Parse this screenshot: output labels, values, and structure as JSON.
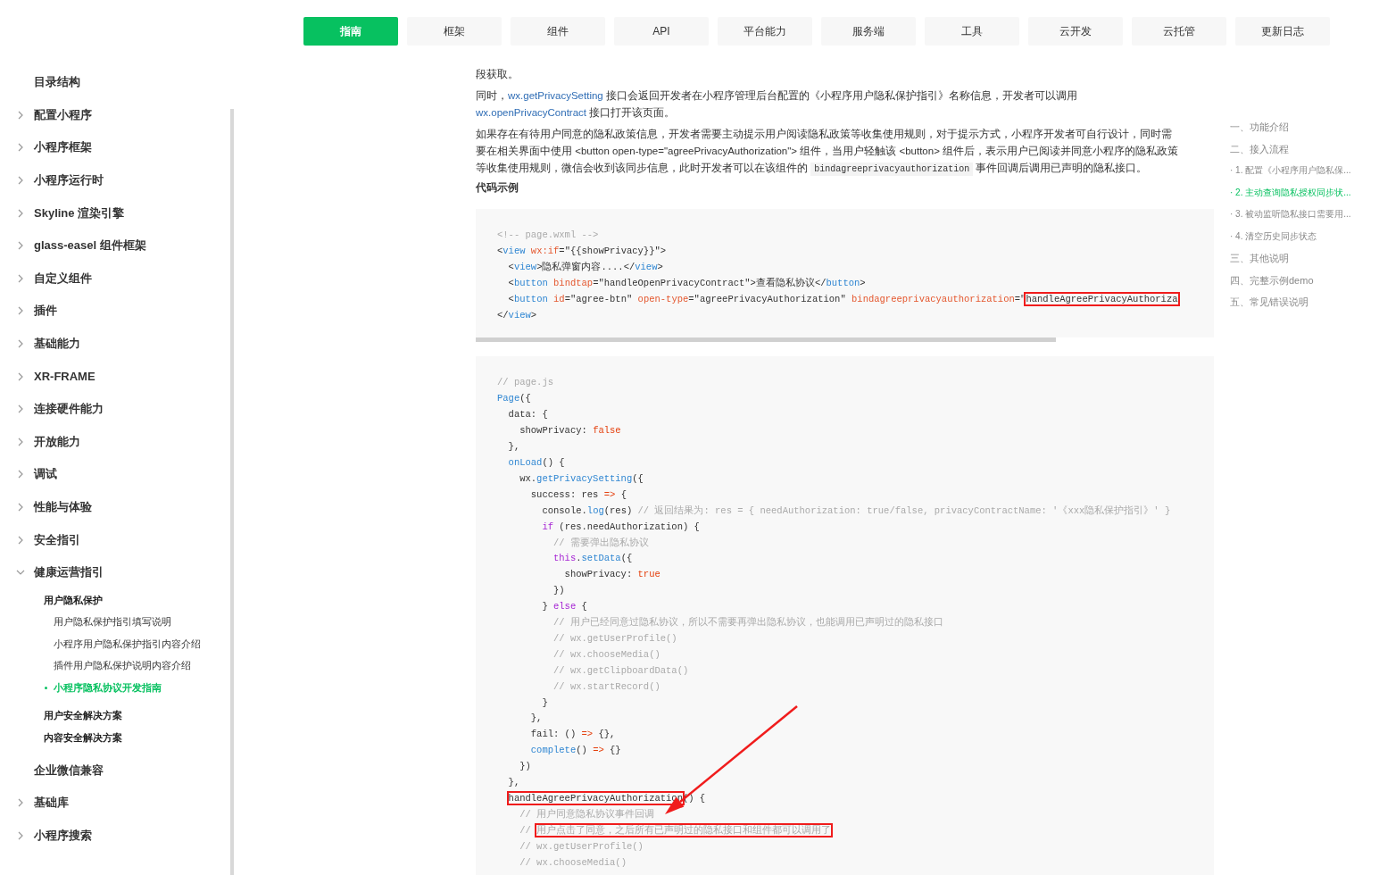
{
  "nav": {
    "tabs": [
      {
        "label": "指南",
        "selected": true
      },
      {
        "label": "框架",
        "selected": false
      },
      {
        "label": "组件",
        "selected": false
      },
      {
        "label": "API",
        "selected": false
      },
      {
        "label": "平台能力",
        "selected": false
      },
      {
        "label": "服务端",
        "selected": false
      },
      {
        "label": "工具",
        "selected": false
      },
      {
        "label": "云开发",
        "selected": false
      },
      {
        "label": "云托管",
        "selected": false
      },
      {
        "label": "更新日志",
        "selected": false
      }
    ]
  },
  "sidebar": {
    "items": [
      {
        "label": "目录结构",
        "kind": "page"
      },
      {
        "label": "配置小程序",
        "kind": "group",
        "expanded": false
      },
      {
        "label": "小程序框架",
        "kind": "group",
        "expanded": false
      },
      {
        "label": "小程序运行时",
        "kind": "group",
        "expanded": false
      },
      {
        "label": "Skyline 渲染引擎",
        "kind": "group",
        "expanded": false
      },
      {
        "label": "glass-easel 组件框架",
        "kind": "group",
        "expanded": false
      },
      {
        "label": "自定义组件",
        "kind": "group",
        "expanded": false
      },
      {
        "label": "插件",
        "kind": "group",
        "expanded": false
      },
      {
        "label": "基础能力",
        "kind": "group",
        "expanded": false
      },
      {
        "label": "XR-FRAME",
        "kind": "group",
        "expanded": false
      },
      {
        "label": "连接硬件能力",
        "kind": "group",
        "expanded": false
      },
      {
        "label": "开放能力",
        "kind": "group",
        "expanded": false
      },
      {
        "label": "调试",
        "kind": "group",
        "expanded": false
      },
      {
        "label": "性能与体验",
        "kind": "group",
        "expanded": false
      },
      {
        "label": "安全指引",
        "kind": "group",
        "expanded": false
      },
      {
        "label": "健康运营指引",
        "kind": "group",
        "expanded": true,
        "children": [
          {
            "label": "用户隐私保护",
            "selected": false,
            "children": [
              {
                "label": "用户隐私保护指引填写说明",
                "selected": false
              },
              {
                "label": "小程序用户隐私保护指引内容介绍",
                "selected": false
              },
              {
                "label": "插件用户隐私保护说明内容介绍",
                "selected": false
              },
              {
                "label": "小程序隐私协议开发指南",
                "selected": true
              }
            ]
          },
          {
            "label": "用户安全解决方案",
            "selected": false
          },
          {
            "label": "内容安全解决方案",
            "selected": false
          }
        ]
      },
      {
        "label": "企业微信兼容",
        "kind": "page"
      },
      {
        "label": "基础库",
        "kind": "group",
        "expanded": false
      },
      {
        "label": "小程序搜索",
        "kind": "group",
        "expanded": false
      }
    ]
  },
  "article": {
    "paragraphs": [
      {
        "segments": [
          {
            "kind": "text",
            "text": "段获取。"
          }
        ]
      },
      {
        "segments": [
          {
            "kind": "text",
            "text": "同时，"
          },
          {
            "kind": "link",
            "text": "wx.getPrivacySetting"
          },
          {
            "kind": "text",
            "text": " 接口会返回开发者在小程序管理后台配置的《小程序用户隐私保护指引》名称信息，开发者可以调用"
          },
          {
            "kind": "break"
          },
          {
            "kind": "link",
            "text": "wx.openPrivacyContract"
          },
          {
            "kind": "text",
            "text": " 接口打开该页面。"
          }
        ]
      },
      {
        "segments": [
          {
            "kind": "text",
            "text": "如果存在有待用户同意的隐私政策信息，开发者需要主动提示用户阅读隐私政策等收集使用规则，对于提示方式，小程序开发者可自行设计，同时需要在相关界面中使用 <button open-type=\"agreePrivacyAuthorization\"> 组件，当用户轻触该 <button> 组件后，表示用户已阅读并同意小程序的隐私政策等收集使用规则，微信会收到该同步信息，此时开发者可以在该组件的 "
          },
          {
            "kind": "code",
            "text": "bindagreeprivacyauthorization"
          },
          {
            "kind": "text",
            "text": " 事件回调后调用已声明的隐私接口。"
          }
        ]
      }
    ],
    "heading": "代码示例",
    "code_blocks": [
      {
        "scrollbar": true,
        "arrow": false,
        "lines": [
          [
            {
              "text": "<!-- page.wxml -->",
              "boxed": false
            }
          ],
          [
            {
              "text": "<view wx:if=\"{{showPrivacy}}\">",
              "boxed": false
            }
          ],
          [
            {
              "text": "  <view>隐私弹窗内容....</view>",
              "boxed": false
            }
          ],
          [
            {
              "text": "  <button bindtap=\"handleOpenPrivacyContract\">查看隐私协议</button>",
              "boxed": false
            }
          ],
          [
            {
              "text": "  <button id=\"agree-btn\" open-type=\"agreePrivacyAuthorization\" bindagreeprivacyauthorization=\"",
              "boxed": false
            },
            {
              "text": "handleAgreePrivacyAuthoriza",
              "boxed": true
            }
          ],
          [
            {
              "text": "</view>",
              "boxed": false
            }
          ]
        ]
      },
      {
        "scrollbar": false,
        "arrow": true,
        "lines": [
          [
            {
              "text": "// page.js",
              "boxed": false
            }
          ],
          [
            {
              "text": "Page({",
              "boxed": false
            }
          ],
          [
            {
              "text": "  data: {",
              "boxed": false
            }
          ],
          [
            {
              "text": "    showPrivacy: false",
              "boxed": false
            }
          ],
          [
            {
              "text": "  },",
              "boxed": false
            }
          ],
          [
            {
              "text": "  onLoad() {",
              "boxed": false
            }
          ],
          [
            {
              "text": "    wx.getPrivacySetting({",
              "boxed": false
            }
          ],
          [
            {
              "text": "      success: res => {",
              "boxed": false
            }
          ],
          [
            {
              "text": "        console.log(res) // 返回结果为: res = { needAuthorization: true/false, privacyContractName: '《xxx隐私保护指引》' }",
              "boxed": false
            }
          ],
          [
            {
              "text": "        if (res.needAuthorization) {",
              "boxed": false
            }
          ],
          [
            {
              "text": "          // 需要弹出隐私协议",
              "boxed": false
            }
          ],
          [
            {
              "text": "          this.setData({",
              "boxed": false
            }
          ],
          [
            {
              "text": "            showPrivacy: true",
              "boxed": false
            }
          ],
          [
            {
              "text": "          })",
              "boxed": false
            }
          ],
          [
            {
              "text": "        } else {",
              "boxed": false
            }
          ],
          [
            {
              "text": "          // 用户已经同意过隐私协议，所以不需要再弹出隐私协议，也能调用已声明过的隐私接口",
              "boxed": false
            }
          ],
          [
            {
              "text": "          // wx.getUserProfile()",
              "boxed": false
            }
          ],
          [
            {
              "text": "          // wx.chooseMedia()",
              "boxed": false
            }
          ],
          [
            {
              "text": "          // wx.getClipboardData()",
              "boxed": false
            }
          ],
          [
            {
              "text": "          // wx.startRecord()",
              "boxed": false
            }
          ],
          [
            {
              "text": "        }",
              "boxed": false
            }
          ],
          [
            {
              "text": "      },",
              "boxed": false
            }
          ],
          [
            {
              "text": "      fail: () => {},",
              "boxed": false
            }
          ],
          [
            {
              "text": "      complete() => {}",
              "boxed": false
            }
          ],
          [
            {
              "text": "    })",
              "boxed": false
            }
          ],
          [
            {
              "text": "  },",
              "boxed": false
            }
          ],
          [
            {
              "text": "  handleAgreePrivacyAuthorization",
              "boxed": true
            },
            {
              "text": "() {",
              "boxed": false
            }
          ],
          [
            {
              "text": "    // 用户同意隐私协议事件回调",
              "boxed": false
            }
          ],
          [
            {
              "text": "    // ",
              "boxed": false
            },
            {
              "text": "用户点击了同意，之后所有已声明过的隐私接口和组件都可以调用了",
              "boxed": true
            }
          ],
          [
            {
              "text": "    // wx.getUserProfile()",
              "boxed": false
            }
          ],
          [
            {
              "text": "    // wx.chooseMedia()",
              "boxed": false
            }
          ]
        ]
      }
    ]
  },
  "toc": {
    "items": [
      {
        "label": "一、功能介绍",
        "selected": false
      },
      {
        "label": "二、接入流程",
        "selected": false,
        "children": [
          {
            "label": "· 1. 配置《小程序用户隐私保...",
            "selected": false
          },
          {
            "label": "· 2. 主动查询隐私授权同步状...",
            "selected": true
          },
          {
            "label": "· 3. 被动监听隐私接口需要用...",
            "selected": false
          },
          {
            "label": "· 4. 清空历史同步状态",
            "selected": false
          }
        ]
      },
      {
        "label": "三、其他说明",
        "selected": false
      },
      {
        "label": "四、完整示例demo",
        "selected": false
      },
      {
        "label": "五、常见错误说明",
        "selected": false
      }
    ]
  }
}
